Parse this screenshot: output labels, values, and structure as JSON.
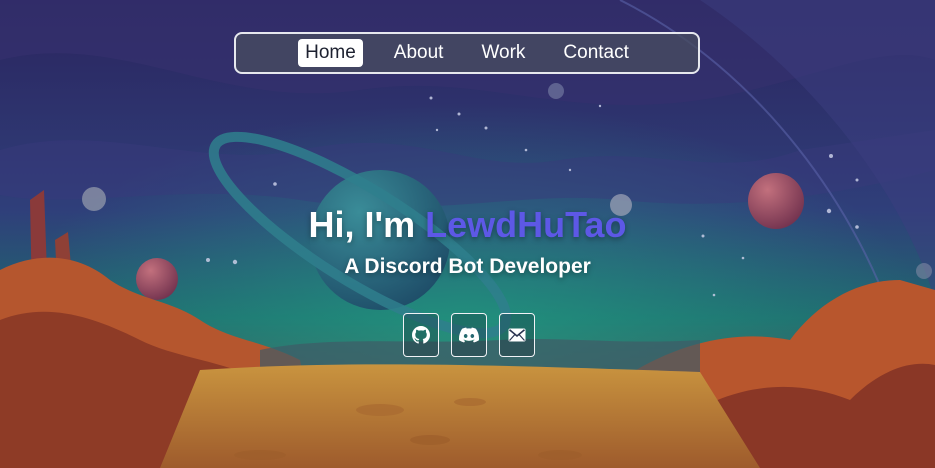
{
  "nav": {
    "items": [
      {
        "label": "Home",
        "active": true
      },
      {
        "label": "About",
        "active": false
      },
      {
        "label": "Work",
        "active": false
      },
      {
        "label": "Contact",
        "active": false
      }
    ]
  },
  "hero": {
    "greeting": "Hi, I'm ",
    "name": "LewdHuTao",
    "subtitle": "A Discord Bot Developer"
  },
  "socials": [
    {
      "icon": "github-icon"
    },
    {
      "icon": "discord-icon"
    },
    {
      "icon": "mail-icon"
    }
  ],
  "colors": {
    "accent": "#5d58e6",
    "text": "#ffffff"
  }
}
